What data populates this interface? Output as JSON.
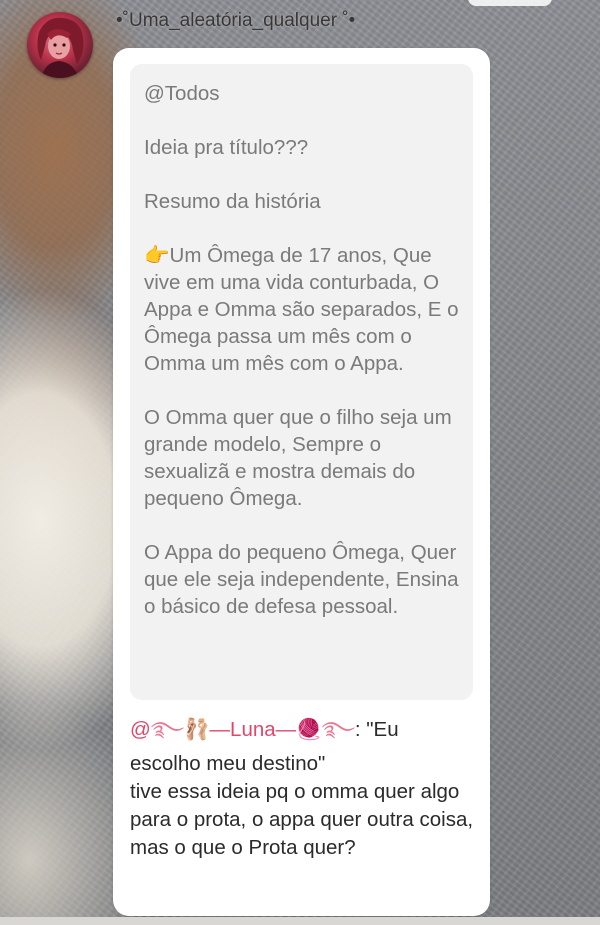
{
  "header": {
    "username": "•˚Uma_aleatória_qualquer ˚•"
  },
  "quote": {
    "line1": "@Todos",
    "line2": "Ideia pra título???",
    "line3": "Resumo da história",
    "para1": "Um Ômega de 17 anos, Que vive em uma vida conturbada, O Appa e Omma são separados, E o Ômega passa um mês com o Omma um mês com o Appa.",
    "para2": "O Omma quer que o filho seja um grande modelo, Sempre o sexualizã e mostra demais do pequeno Ômega.",
    "para3": "O Appa do pequeno Ômega, Quer que ele seja independente, Ensina o básico de defesa pessoal."
  },
  "reply": {
    "mention_prefix": "@",
    "mention_name": "—Luna—",
    "colon_quote": ": \"Eu",
    "text1": "escolho meu destino\"",
    "text2": "tive essa ideia pq o omma quer algo para o prota, o appa quer outra coisa, mas o que o Prota quer?"
  },
  "icons": {
    "pointing": "backhand-index-pointing-right-icon",
    "mention_deco_left": "swirl-ribbon-icon",
    "mention_deco_shoes": "ballet-shoes-icon",
    "mention_deco_ball": "yarn-ball-icon",
    "mention_deco_right": "swirl-ribbon-icon"
  },
  "colors": {
    "mention": "#e0476a",
    "quote_text": "#7a7a7a",
    "body_text": "#2b2b2b"
  }
}
